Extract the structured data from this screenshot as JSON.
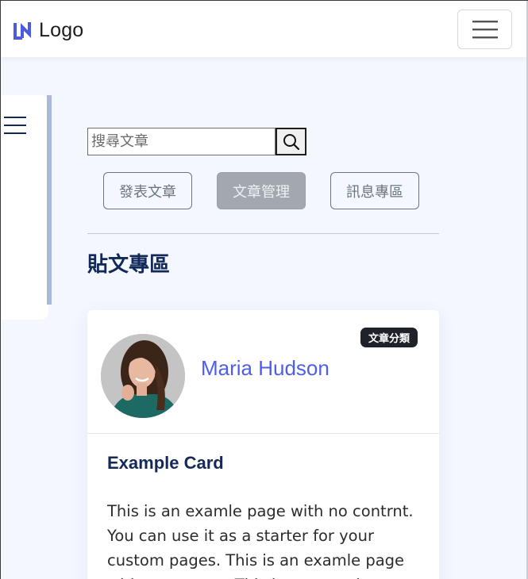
{
  "navbar": {
    "logo_text": "Logo",
    "logo_icon": "logo-mark-icon",
    "toggle_icon": "hamburger-icon"
  },
  "sidebar": {
    "menu_icon": "hamburger-icon"
  },
  "search": {
    "placeholder": "搜尋文章",
    "value": "",
    "button_icon": "search-icon"
  },
  "actions": {
    "post_label": "發表文章",
    "manage_label": "文章管理",
    "messages_label": "訊息專區"
  },
  "section": {
    "title": "貼文專區"
  },
  "card": {
    "category_badge": "文章分類",
    "author": "Maria Hudson",
    "title": "Example Card",
    "body": "This is an examle page with no contrnt. You can use it as a starter for your custom pages. This is an examle page with no contrnt. This is an examle page"
  },
  "colors": {
    "page_bg": "#f4f7fe",
    "heading": "#12295a",
    "author_link": "#4f5ee8",
    "badge_bg": "#1f2229",
    "secondary": "#6c757d",
    "logo": "#4b5bdc"
  }
}
